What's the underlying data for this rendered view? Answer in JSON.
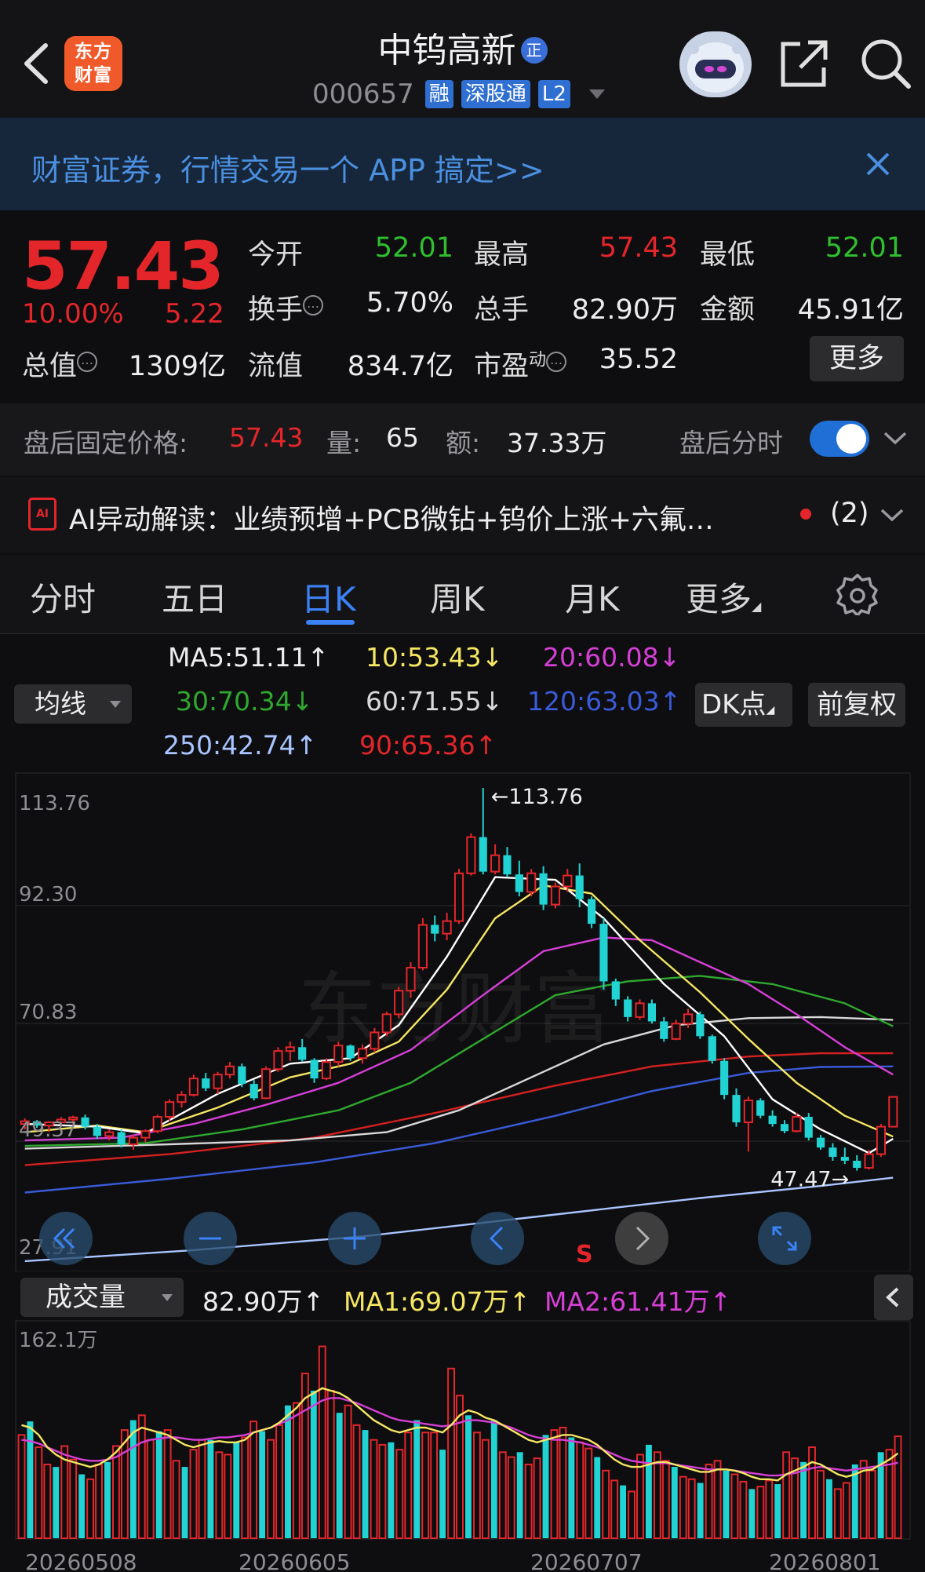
{
  "header": {
    "logo_text_1": "东方",
    "logo_text_2": "财富",
    "title": "中钨高新",
    "title_badge": "正",
    "code": "000657",
    "tags": [
      "融",
      "深股通",
      "L2"
    ]
  },
  "banner": {
    "text": "财富证券，行情交易一个 APP 搞定>>"
  },
  "quote": {
    "price": "57.43",
    "change_pct": "10.00%",
    "change": "5.22",
    "open_label": "今开",
    "open": "52.01",
    "high_label": "最高",
    "high": "57.43",
    "low_label": "最低",
    "low": "52.01",
    "turnover_label": "换手",
    "turnover": "5.70%",
    "volume_label": "总手",
    "volume": "82.90万",
    "amount_label": "金额",
    "amount": "45.91亿",
    "mktcap_label": "总值",
    "mktcap": "1309亿",
    "float_label": "流值",
    "float": "834.7亿",
    "pe_label": "市盈",
    "pe_sup": "动",
    "pe": "35.52",
    "more_label": "更多"
  },
  "after_hours": {
    "label": "盘后固定价格:",
    "price": "57.43",
    "vol_label": "量:",
    "vol": "65",
    "amt_label": "额:",
    "amt": "37.33万",
    "toggle_label": "盘后分时",
    "toggle_on": true
  },
  "ai": {
    "icon_text": "AI",
    "text": "AI异动解读：业绩预增+PCB微钻+钨价上涨+六氟…",
    "count": "(2)"
  },
  "tabs": [
    "分时",
    "五日",
    "日K",
    "周K",
    "月K",
    "更多"
  ],
  "active_tab": 2,
  "ma_legend": {
    "select_label": "均线",
    "ma5": "MA5:51.11↑",
    "ma10": "10:53.43↓",
    "ma20": "20:60.08↓",
    "ma30": "30:70.34↓",
    "ma60": "60:71.55↓",
    "ma120": "120:63.03↑",
    "ma250": "250:42.74↑",
    "ma90": "90:65.36↑",
    "dk_label": "DK点",
    "fq_label": "前复权"
  },
  "colors": {
    "up": "#e4262b",
    "down": "#22d3d3",
    "ma5": "#ffffff",
    "ma10": "#f5e663",
    "ma20": "#d63fd6",
    "ma30": "#2fa82f",
    "ma60": "#d8d8d8",
    "ma120": "#3a5bd9",
    "ma250": "#a9c4ff",
    "ma90": "#d42020",
    "accent": "#3b82f6"
  },
  "chart_data": [
    {
      "type": "candlestick",
      "y_ticks": [
        "113.76",
        "92.30",
        "70.83",
        "49.37",
        "27.91"
      ],
      "ylim": [
        27.91,
        113.76
      ],
      "annotations": {
        "max": "←113.76",
        "min": "47.47→"
      },
      "signal_label": "S",
      "candles": [
        [
          52.5,
          53.5,
          51.5,
          53.0
        ],
        [
          53.0,
          53.2,
          51.8,
          52.2
        ],
        [
          52.2,
          53.0,
          51.0,
          52.8
        ],
        [
          52.8,
          53.8,
          52.0,
          53.3
        ],
        [
          53.3,
          54.0,
          52.5,
          53.7
        ],
        [
          53.7,
          54.2,
          51.5,
          52.0
        ],
        [
          52.0,
          52.5,
          49.8,
          50.3
        ],
        [
          50.3,
          51.5,
          49.5,
          51.0
        ],
        [
          51.0,
          51.5,
          48.2,
          48.8
        ],
        [
          48.8,
          50.5,
          47.8,
          50.0
        ],
        [
          50.0,
          51.5,
          49.2,
          51.2
        ],
        [
          51.2,
          54.2,
          50.8,
          53.8
        ],
        [
          53.8,
          57.0,
          53.0,
          56.5
        ],
        [
          56.5,
          58.5,
          55.5,
          57.8
        ],
        [
          57.8,
          61.5,
          57.5,
          60.8
        ],
        [
          60.8,
          61.8,
          58.5,
          59.0
        ],
        [
          59.0,
          62.0,
          58.0,
          61.5
        ],
        [
          61.5,
          63.8,
          60.8,
          63.0
        ],
        [
          63.0,
          63.5,
          59.2,
          59.8
        ],
        [
          59.8,
          60.5,
          56.8,
          57.2
        ],
        [
          57.2,
          63.0,
          57.0,
          62.5
        ],
        [
          62.5,
          66.5,
          62.0,
          65.8
        ],
        [
          65.8,
          67.5,
          64.0,
          66.5
        ],
        [
          66.5,
          68.0,
          63.8,
          64.2
        ],
        [
          64.2,
          64.5,
          60.0,
          60.8
        ],
        [
          60.8,
          64.5,
          60.5,
          63.8
        ],
        [
          63.8,
          67.5,
          63.0,
          66.8
        ],
        [
          66.8,
          67.0,
          64.0,
          64.5
        ],
        [
          64.5,
          67.0,
          63.5,
          66.2
        ],
        [
          66.2,
          70.0,
          65.5,
          69.2
        ],
        [
          69.2,
          73.0,
          68.5,
          72.5
        ],
        [
          72.5,
          77.5,
          71.8,
          76.8
        ],
        [
          76.8,
          82.0,
          75.5,
          81.0
        ],
        [
          81.0,
          90.0,
          80.5,
          88.8
        ],
        [
          88.8,
          90.5,
          85.8,
          87.2
        ],
        [
          87.2,
          91.0,
          86.0,
          89.5
        ],
        [
          89.5,
          99.0,
          89.0,
          98.2
        ],
        [
          98.2,
          105.5,
          97.8,
          104.8
        ],
        [
          104.8,
          113.76,
          98.0,
          98.5
        ],
        [
          98.5,
          103.5,
          98.0,
          101.5
        ],
        [
          101.5,
          103.0,
          97.5,
          98.0
        ],
        [
          98.0,
          100.5,
          94.0,
          94.8
        ],
        [
          94.8,
          99.0,
          94.0,
          98.2
        ],
        [
          98.2,
          99.5,
          91.5,
          92.5
        ],
        [
          92.5,
          96.5,
          91.8,
          95.8
        ],
        [
          95.8,
          99.0,
          94.8,
          97.8
        ],
        [
          97.8,
          100.0,
          92.0,
          93.5
        ],
        [
          93.5,
          94.0,
          88.2,
          89.0
        ],
        [
          89.0,
          90.0,
          77.0,
          78.5
        ],
        [
          78.5,
          79.0,
          74.0,
          75.2
        ],
        [
          75.2,
          75.8,
          71.2,
          72.0
        ],
        [
          72.0,
          75.2,
          71.5,
          74.5
        ],
        [
          74.5,
          75.2,
          70.8,
          71.2
        ],
        [
          71.2,
          72.0,
          67.5,
          68.0
        ],
        [
          68.0,
          71.5,
          67.8,
          70.8
        ],
        [
          70.8,
          73.5,
          70.0,
          72.5
        ],
        [
          72.5,
          73.0,
          68.0,
          68.5
        ],
        [
          68.5,
          68.8,
          63.5,
          64.0
        ],
        [
          64.0,
          64.5,
          57.0,
          57.8
        ],
        [
          57.8,
          59.0,
          52.0,
          52.8
        ],
        [
          52.8,
          57.5,
          47.47,
          56.8
        ],
        [
          56.8,
          57.2,
          53.5,
          54.0
        ],
        [
          54.0,
          55.0,
          52.0,
          52.5
        ],
        [
          52.5,
          53.2,
          50.8,
          51.2
        ],
        [
          51.2,
          54.5,
          51.0,
          53.8
        ],
        [
          53.8,
          54.5,
          49.5,
          50.0
        ],
        [
          50.0,
          50.5,
          47.8,
          48.2
        ],
        [
          48.2,
          49.0,
          45.8,
          46.5
        ],
        [
          46.5,
          48.2,
          45.2,
          45.8
        ],
        [
          45.8,
          46.8,
          44.0,
          44.5
        ],
        [
          44.5,
          47.8,
          44.2,
          47.0
        ],
        [
          47.0,
          52.5,
          46.5,
          52.01
        ],
        [
          52.01,
          57.43,
          52.01,
          57.43
        ]
      ],
      "ma_lines": {
        "ma5": [
          [
            0,
            52.5
          ],
          [
            6,
            52.0
          ],
          [
            10,
            50.8
          ],
          [
            16,
            58.0
          ],
          [
            22,
            63.5
          ],
          [
            27,
            64.5
          ],
          [
            31,
            70.5
          ],
          [
            35,
            83.0
          ],
          [
            39,
            97.5
          ],
          [
            44,
            97.0
          ],
          [
            48,
            90.0
          ],
          [
            53,
            78.0
          ],
          [
            58,
            68.5
          ],
          [
            62,
            57.0
          ],
          [
            66,
            51.5
          ],
          [
            70,
            47.2
          ],
          [
            72,
            49.8
          ]
        ],
        "ma10": [
          [
            0,
            51.0
          ],
          [
            6,
            52.2
          ],
          [
            10,
            51.0
          ],
          [
            16,
            55.5
          ],
          [
            22,
            61.0
          ],
          [
            27,
            63.5
          ],
          [
            31,
            67.5
          ],
          [
            35,
            77.0
          ],
          [
            39,
            90.0
          ],
          [
            43,
            96.0
          ],
          [
            47,
            94.5
          ],
          [
            51,
            86.0
          ],
          [
            56,
            76.5
          ],
          [
            60,
            68.0
          ],
          [
            64,
            60.0
          ],
          [
            68,
            54.0
          ],
          [
            72,
            50.2
          ]
        ],
        "ma20": [
          [
            0,
            49.5
          ],
          [
            8,
            50.0
          ],
          [
            14,
            52.5
          ],
          [
            20,
            56.0
          ],
          [
            26,
            60.0
          ],
          [
            32,
            66.0
          ],
          [
            38,
            76.0
          ],
          [
            43,
            84.0
          ],
          [
            48,
            86.5
          ],
          [
            52,
            86.0
          ],
          [
            56,
            82.0
          ],
          [
            60,
            78.0
          ],
          [
            64,
            72.5
          ],
          [
            68,
            66.5
          ],
          [
            72,
            61.5
          ]
        ],
        "ma30": [
          [
            0,
            48.5
          ],
          [
            10,
            49.0
          ],
          [
            18,
            51.5
          ],
          [
            26,
            55.0
          ],
          [
            32,
            60.0
          ],
          [
            38,
            68.0
          ],
          [
            44,
            76.0
          ],
          [
            50,
            78.5
          ],
          [
            56,
            79.5
          ],
          [
            62,
            78.0
          ],
          [
            68,
            74.5
          ],
          [
            72,
            70.3
          ]
        ],
        "ma60": [
          [
            0,
            48.0
          ],
          [
            12,
            48.8
          ],
          [
            22,
            49.5
          ],
          [
            30,
            51.0
          ],
          [
            36,
            55.0
          ],
          [
            42,
            61.0
          ],
          [
            48,
            67.0
          ],
          [
            54,
            70.5
          ],
          [
            60,
            71.8
          ],
          [
            66,
            72.0
          ],
          [
            72,
            71.5
          ]
        ],
        "ma90": [
          [
            0,
            45.0
          ],
          [
            12,
            47.0
          ],
          [
            24,
            50.0
          ],
          [
            34,
            54.5
          ],
          [
            44,
            59.5
          ],
          [
            52,
            63.0
          ],
          [
            60,
            64.8
          ],
          [
            66,
            65.4
          ],
          [
            72,
            65.4
          ]
        ],
        "ma120": [
          [
            0,
            40.0
          ],
          [
            12,
            42.5
          ],
          [
            24,
            45.5
          ],
          [
            34,
            49.0
          ],
          [
            44,
            54.0
          ],
          [
            52,
            58.5
          ],
          [
            60,
            61.8
          ],
          [
            66,
            62.9
          ],
          [
            72,
            63.0
          ]
        ],
        "ma250": [
          [
            0,
            27.5
          ],
          [
            14,
            29.5
          ],
          [
            28,
            32.0
          ],
          [
            42,
            35.5
          ],
          [
            56,
            39.0
          ],
          [
            66,
            41.2
          ],
          [
            72,
            42.7
          ]
        ]
      }
    },
    {
      "type": "bar",
      "title": "成交量",
      "legend": {
        "vol": "82.90万↑",
        "ma1": "MA1:69.07万↑",
        "ma2": "MA2:61.41万↑"
      },
      "y_ticks": [
        "162.1万"
      ],
      "ylim": [
        0,
        162.1
      ],
      "x_ticks": [
        "20260508",
        "20260605",
        "20260707",
        "20260801"
      ],
      "values": [
        84,
        95,
        74,
        60,
        58,
        75,
        64,
        52,
        48,
        60,
        62,
        75,
        88,
        96,
        100,
        80,
        87,
        88,
        63,
        58,
        72,
        80,
        80,
        70,
        68,
        78,
        82,
        95,
        87,
        80,
        92,
        108,
        110,
        134,
        120,
        156,
        120,
        102,
        108,
        92,
        88,
        80,
        76,
        78,
        72,
        86,
        96,
        86,
        86,
        72,
        138,
        116,
        100,
        86,
        80,
        96,
        70,
        66,
        70,
        60,
        65,
        84,
        88,
        90,
        82,
        78,
        73,
        66,
        55,
        47,
        43,
        38,
        68,
        76,
        70,
        63,
        58,
        50,
        48,
        45,
        60,
        63,
        55,
        52,
        46,
        40,
        42,
        47,
        44,
        70,
        65,
        62,
        74,
        55,
        48,
        40,
        45,
        60,
        63,
        55,
        70,
        72,
        82.9
      ],
      "ma1": [
        92,
        90,
        84,
        74,
        68,
        64,
        62,
        60,
        58,
        60,
        64,
        70,
        78,
        86,
        90,
        88,
        86,
        84,
        80,
        76,
        74,
        76,
        78,
        79,
        78,
        78,
        80,
        86,
        88,
        90,
        94,
        100,
        106,
        114,
        118,
        122,
        120,
        118,
        114,
        108,
        102,
        96,
        92,
        88,
        86,
        88,
        90,
        90,
        88,
        86,
        92,
        100,
        104,
        102,
        98,
        96,
        92,
        88,
        84,
        80,
        78,
        80,
        82,
        84,
        84,
        82,
        80,
        76,
        70,
        64,
        60,
        58,
        58,
        60,
        62,
        62,
        60,
        58,
        56,
        54,
        54,
        56,
        56,
        55,
        53,
        50,
        48,
        48,
        47,
        52,
        55,
        58,
        62,
        60,
        56,
        52,
        50,
        52,
        55,
        56,
        60,
        64,
        69.07
      ],
      "ma2": [
        80,
        79,
        77,
        74,
        71,
        68,
        66,
        64,
        63,
        63,
        64,
        66,
        70,
        74,
        78,
        80,
        81,
        82,
        82,
        81,
        80,
        80,
        81,
        82,
        82,
        83,
        84,
        86,
        88,
        90,
        93,
        96,
        100,
        104,
        108,
        112,
        114,
        114,
        112,
        110,
        107,
        104,
        101,
        98,
        96,
        95,
        94,
        93,
        92,
        91,
        92,
        94,
        96,
        96,
        95,
        94,
        92,
        90,
        87,
        84,
        82,
        81,
        80,
        80,
        79,
        78,
        76,
        74,
        71,
        68,
        65,
        63,
        62,
        61,
        61,
        61,
        60,
        59,
        58,
        57,
        56,
        56,
        56,
        55,
        54,
        53,
        52,
        51,
        51,
        52,
        53,
        55,
        57,
        58,
        57,
        56,
        55,
        56,
        57,
        58,
        59,
        60,
        61.41
      ]
    }
  ]
}
